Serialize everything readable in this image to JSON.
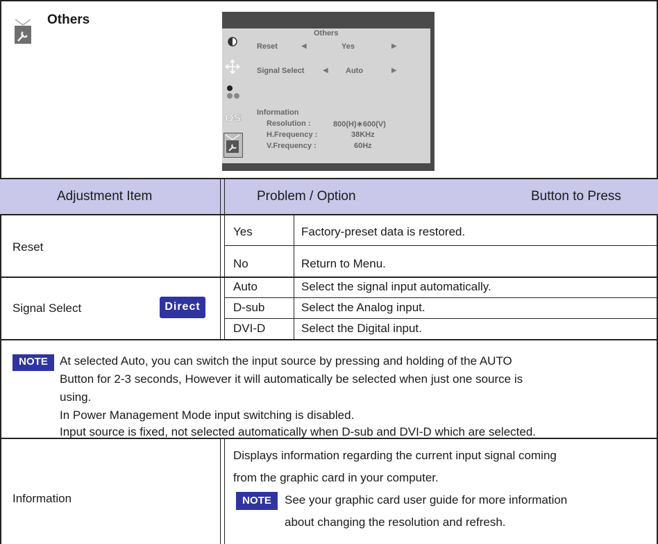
{
  "section": {
    "title": "Others"
  },
  "osd": {
    "title": "Others",
    "reset_label": "Reset",
    "reset_value": "Yes",
    "signal_label": "Signal Select",
    "signal_value": "Auto",
    "info_label": "Information",
    "resolution_label": "Resolution :",
    "resolution_value": "800(H)∗600(V)",
    "hfreq_label": "H.Frequency :",
    "hfreq_value": "38KHz",
    "vfreq_label": "V.Frequency :",
    "vfreq_value": "60Hz",
    "arrow_left": "◀",
    "arrow_right": "▶"
  },
  "table": {
    "headers": {
      "item": "Adjustment Item",
      "problem": "Problem / Option",
      "button": "Button to Press"
    },
    "reset": {
      "label": "Reset",
      "options": [
        {
          "option": "Yes",
          "desc": "Factory-preset data is restored."
        },
        {
          "option": "No",
          "desc": "Return to Menu."
        }
      ]
    },
    "signal": {
      "label": "Signal Select",
      "badge": "Direct",
      "options": [
        {
          "option": "Auto",
          "desc": "Select the signal input automatically."
        },
        {
          "option": "D-sub",
          "desc": "Select the Analog input."
        },
        {
          "option": "DVI-D",
          "desc": "Select the Digital input."
        }
      ]
    },
    "note": {
      "badge": "NOTE",
      "lines": [
        "At selected Auto, you can switch the input source by pressing and holding of the AUTO",
        "Button for 2-3 seconds, However it will automatically be selected when just one source is",
        "using.",
        "In Power Management Mode input switching is disabled.",
        "Input source is fixed, not selected automatically when D-sub and DVI-D which are selected."
      ]
    },
    "information": {
      "label": "Information",
      "lines": [
        "Displays information regarding the current input signal coming",
        "from the graphic card in your computer."
      ],
      "note_badge": "NOTE",
      "note_lines": [
        "See your graphic card user guide for more information",
        "about changing the resolution and refresh."
      ]
    }
  },
  "colors": {
    "header_bg": "#c9c8ea",
    "badge_bg": "#3034a0"
  }
}
